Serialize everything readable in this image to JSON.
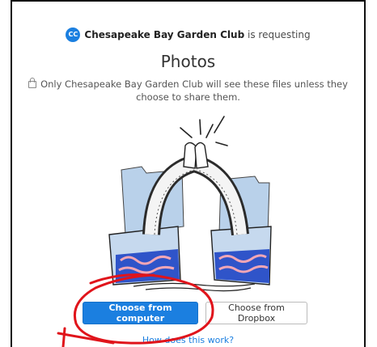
{
  "requester": {
    "badge": "CC",
    "name": "Chesapeake Bay Garden Club",
    "suffix": " is requesting"
  },
  "title": "Photos",
  "notice": "Only Chesapeake Bay Garden Club will see these files unless they choose to share them.",
  "buttons": {
    "primary": "Choose from computer",
    "secondary": "Choose from Dropbox"
  },
  "help_link": "How does this work?",
  "icons": {
    "lock": "lock-icon",
    "badge": "avatar-badge"
  },
  "colors": {
    "accent": "#1b7fe0",
    "annotation": "#e0141b"
  }
}
